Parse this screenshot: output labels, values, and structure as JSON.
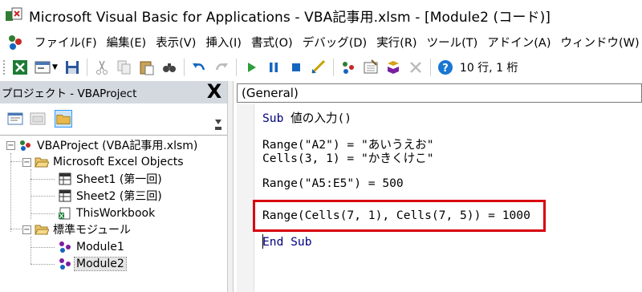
{
  "window": {
    "title": "Microsoft Visual Basic for Applications - VBA記事用.xlsm - [Module2 (コード)]"
  },
  "menu": {
    "items": [
      {
        "label": "ファイル(F)"
      },
      {
        "label": "編集(E)"
      },
      {
        "label": "表示(V)"
      },
      {
        "label": "挿入(I)"
      },
      {
        "label": "書式(O)"
      },
      {
        "label": "デバッグ(D)"
      },
      {
        "label": "実行(R)"
      },
      {
        "label": "ツール(T)"
      },
      {
        "label": "アドイン(A)"
      },
      {
        "label": "ウィンドウ(W)"
      }
    ]
  },
  "toolbar": {
    "cursor_position": "10 行, 1 桁"
  },
  "project": {
    "title": "プロジェクト - VBAProject",
    "close_label": "X",
    "tree": {
      "root": "VBAProject (VBA記事用.xlsm)",
      "excel_objects": "Microsoft Excel Objects",
      "sheet1": "Sheet1 (第一回)",
      "sheet2": "Sheet2 (第三回)",
      "workbook": "ThisWorkbook",
      "modules_folder": "標準モジュール",
      "module1": "Module1",
      "module2": "Module2",
      "expander_open": "−"
    }
  },
  "editor": {
    "object_combo": "(General)",
    "lines": {
      "l1_kw": "Sub",
      "l1_rest": " 値の入力()",
      "l3": "Range(\"A2\") = \"あいうえお\"",
      "l4": "Cells(3, 1) = \"かきくけこ\"",
      "l6": "Range(\"A5:E5\") = 500",
      "l8": "Range(Cells(7, 1), Cells(7, 5)) = 1000",
      "l10_kw": "End Sub"
    }
  },
  "colors": {
    "highlight_border": "#d7000f",
    "keyword": "#00007f",
    "panel_header": "#d4d9e0"
  }
}
